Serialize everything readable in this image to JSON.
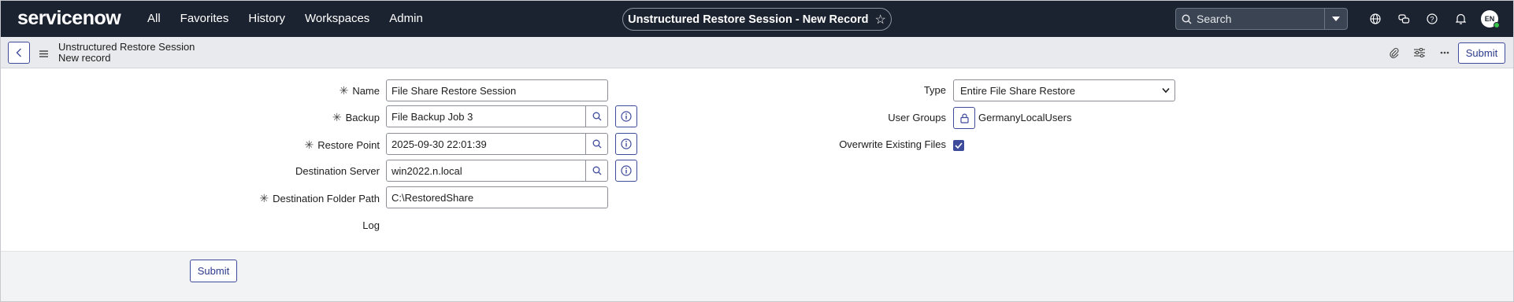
{
  "nav": {
    "logo": "servicenow",
    "links": [
      "All",
      "Favorites",
      "History",
      "Workspaces",
      "Admin"
    ],
    "record_title": "Unstructured Restore Session - New Record",
    "search_placeholder": "Search",
    "avatar_initials": "EN"
  },
  "header": {
    "table_name": "Unstructured Restore Session",
    "record_label": "New record",
    "submit_label": "Submit"
  },
  "form": {
    "name": {
      "label": "Name",
      "required": true,
      "value": "File Share Restore Session"
    },
    "backup": {
      "label": "Backup",
      "required": true,
      "value": "File Backup Job 3"
    },
    "restore_point": {
      "label": "Restore Point",
      "required": true,
      "value": "2025-09-30 22:01:39"
    },
    "destination_server": {
      "label": "Destination Server",
      "required": false,
      "value": "win2022.n.local"
    },
    "destination_folder_path": {
      "label": "Destination Folder Path",
      "required": true,
      "value": "C:\\RestoredShare"
    },
    "log": {
      "label": "Log"
    },
    "type": {
      "label": "Type",
      "value": "Entire File Share Restore"
    },
    "user_groups": {
      "label": "User Groups",
      "value": "GermanyLocalUsers"
    },
    "overwrite": {
      "label": "Overwrite Existing Files",
      "checked": true
    }
  },
  "footer": {
    "submit_label": "Submit"
  },
  "colors": {
    "nav_bg": "#1c2330",
    "accent": "#3e4b9b",
    "logo_green": "#62d84e"
  },
  "icons": [
    "star-icon",
    "search-icon",
    "chevron-down-icon",
    "globe-icon",
    "chat-icon",
    "help-icon",
    "bell-icon",
    "back-icon",
    "menu-icon",
    "paperclip-icon",
    "settings-icon",
    "more-icon",
    "magnifier-icon",
    "info-icon",
    "lock-icon",
    "checkbox-icon"
  ]
}
